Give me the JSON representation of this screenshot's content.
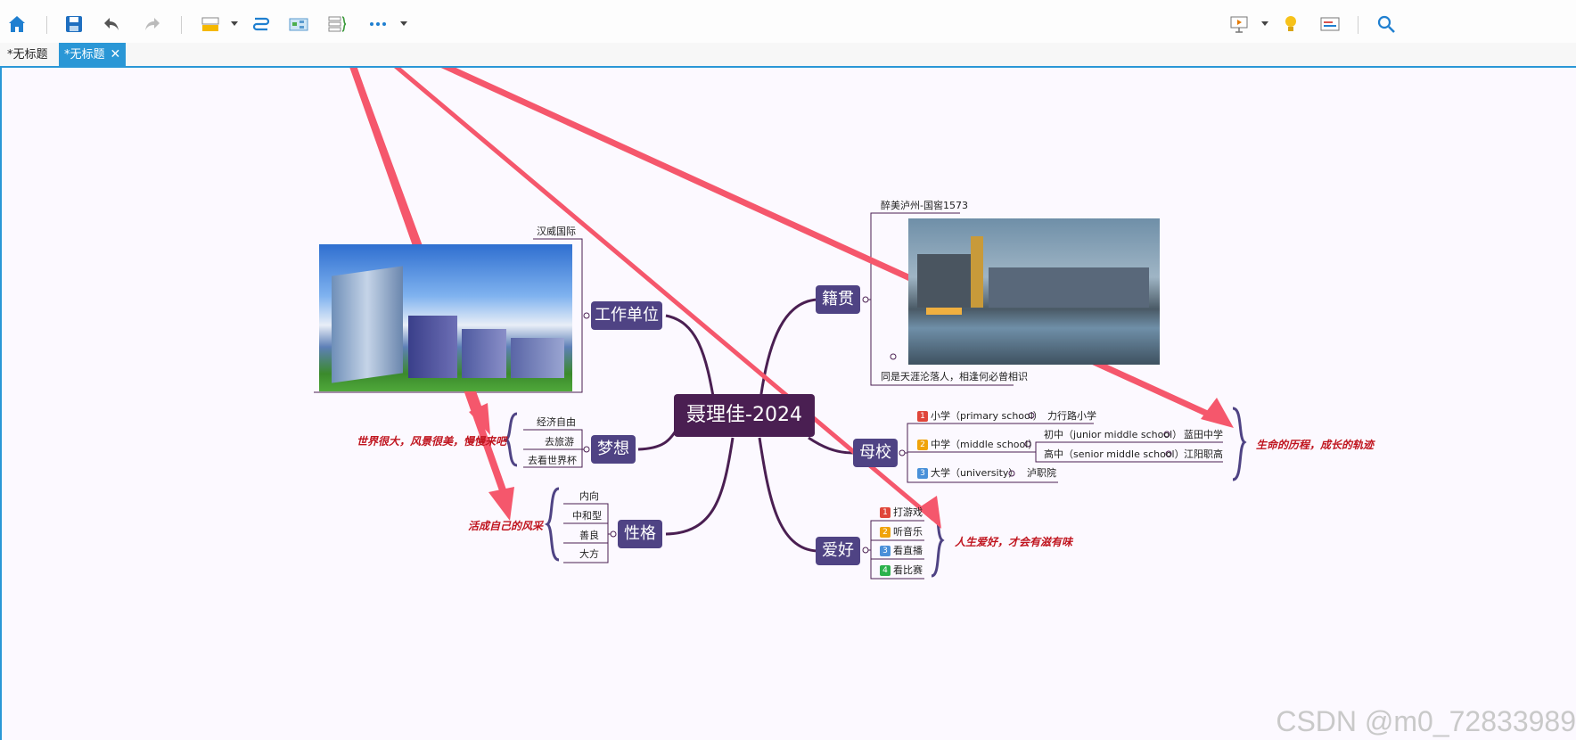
{
  "tabs": [
    {
      "label": "*无标题"
    },
    {
      "label": "*无标题",
      "close": "✕"
    }
  ],
  "mindmap": {
    "center": "聂理佳-2024",
    "work": {
      "label": "工作单位",
      "leaf": "汉威国际"
    },
    "dream": {
      "label": "梦想",
      "items": [
        "经济自由",
        "去旅游",
        "去看世界杯"
      ],
      "note": "世界很大，风景很美，慢慢来吧"
    },
    "character": {
      "label": "性格",
      "items": [
        "内向",
        "中和型",
        "善良",
        "大方"
      ],
      "note": "活成自己的风采"
    },
    "hometown": {
      "label": "籍贯",
      "top": "醉美泸州-国窖1573",
      "bottom": "同是天涯沦落人，相逢何必曾相识"
    },
    "school": {
      "label": "母校",
      "primary": {
        "badge": "1",
        "label": "小学（primary school）",
        "value": "力行路小学"
      },
      "middle": {
        "badge": "2",
        "label": "中学（middle school）",
        "junior": {
          "label": "初中（junior middle school）",
          "value": "蓝田中学"
        },
        "senior": {
          "label": "高中（senior middle school）",
          "value": "江阳职高"
        }
      },
      "university": {
        "badge": "3",
        "label": "大学（university）",
        "value": "泸职院"
      },
      "note": "生命的历程，成长的轨迹"
    },
    "hobby": {
      "label": "爱好",
      "items": [
        {
          "badge": "1",
          "label": "打游戏"
        },
        {
          "badge": "2",
          "label": "听音乐"
        },
        {
          "badge": "3",
          "label": "看直播"
        },
        {
          "badge": "4",
          "label": "看比赛"
        }
      ],
      "note": "人生爱好，才会有滋有味"
    }
  },
  "colors": {
    "accent": "#2a97d6",
    "branch": "#4a1f52",
    "node": "#4f4384",
    "arrow": "#f5576c",
    "annotation": "#c0151f",
    "badge1": "#e0463a",
    "badge2": "#f0a30a",
    "badge3": "#4a90d9",
    "badge4": "#2bb24c"
  },
  "watermark": "CSDN @m0_72833989"
}
